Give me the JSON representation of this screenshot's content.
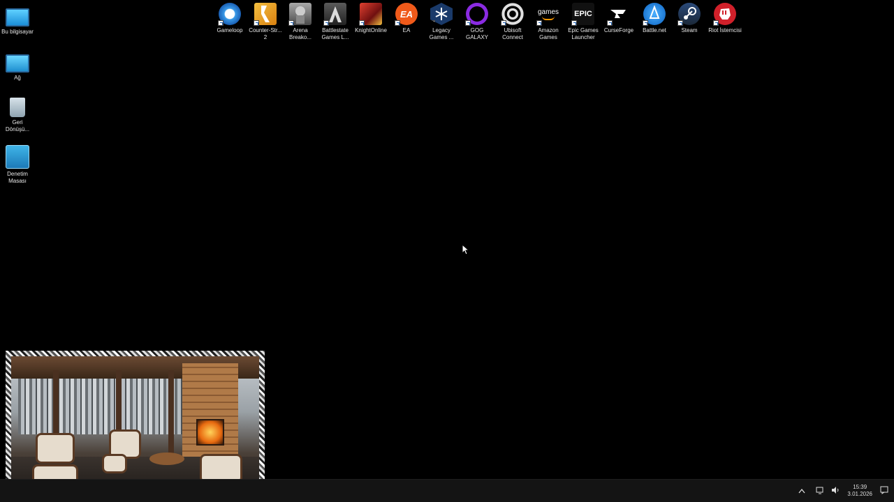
{
  "desktop": {
    "left_icons": [
      {
        "label": "Bu bilgisayar",
        "icon": "computer-icon"
      },
      {
        "label": "Ağ",
        "icon": "network-icon"
      },
      {
        "label": "Geri Dönüşü...",
        "icon": "recycle-bin-icon"
      },
      {
        "label": "Denetim Masası",
        "icon": "control-panel-icon"
      }
    ],
    "top_icons": [
      {
        "label": "Gameloop",
        "icon": "gameloop-icon",
        "color": "#3a9be8"
      },
      {
        "label": "Counter-Str... 2",
        "icon": "counter-strike-icon",
        "color": "#e8a020"
      },
      {
        "label": "Arena Breako...",
        "icon": "arena-breakout-icon",
        "color": "#8a8a8a"
      },
      {
        "label": "Battlestate Games L...",
        "icon": "battlestate-icon",
        "color": "#3a3a3a"
      },
      {
        "label": "KnightOnline",
        "icon": "knightonline-icon",
        "color": "#b02020"
      },
      {
        "label": "EA",
        "icon": "ea-icon",
        "color": "#f05a1a"
      },
      {
        "label": "Legacy Games ...",
        "icon": "legacy-games-icon",
        "color": "#1a3a6a"
      },
      {
        "label": "GOG GALAXY",
        "icon": "gog-galaxy-icon",
        "color": "#8a2be2"
      },
      {
        "label": "Ubisoft Connect",
        "icon": "ubisoft-icon",
        "color": "#e0e0e0"
      },
      {
        "label": "Amazon Games",
        "icon": "amazon-games-icon",
        "color": "#000000"
      },
      {
        "label": "Epic Games Launcher",
        "icon": "epic-games-icon",
        "color": "#111111"
      },
      {
        "label": "CurseForge",
        "icon": "curseforge-icon",
        "color": "#111111"
      },
      {
        "label": "Battle.net",
        "icon": "battlenet-icon",
        "color": "#1a8ae8"
      },
      {
        "label": "Steam",
        "icon": "steam-icon",
        "color": "#1b2838"
      },
      {
        "label": "Riot İstemcisi",
        "icon": "riot-icon",
        "color": "#d0202a"
      }
    ]
  },
  "icon_glyphs": {
    "amazon": "games",
    "epic": "EPIC",
    "ea": "EA"
  },
  "taskbar": {
    "tray_chevron": "^",
    "time": "15:39",
    "date": "3.01.2026"
  }
}
